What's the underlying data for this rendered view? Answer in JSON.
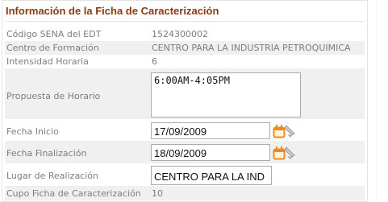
{
  "section": {
    "title": "Información de la Ficha de Caracterización"
  },
  "fields": {
    "codigo": {
      "label": "Código SENA del EDT",
      "value": "1524300002"
    },
    "centro": {
      "label": "Centro de Formación",
      "value": "CENTRO PARA LA INDUSTRIA PETROQUIMICA"
    },
    "intensidad": {
      "label": "Intensidad Horaria",
      "value": "6"
    },
    "propuesta": {
      "label": "Propuesta de Horario",
      "value": "6:00AM-4:05PM"
    },
    "fecha_inicio": {
      "label": "Fecha Inicio",
      "value": "17/09/2009",
      "icon": "calendar-icon"
    },
    "fecha_fin": {
      "label": "Fecha Finalización",
      "value": "18/09/2009",
      "icon": "calendar-icon"
    },
    "lugar": {
      "label": "Lugar de Realización",
      "value": "CENTRO PARA LA IND"
    },
    "cupo": {
      "label": "Cupo Ficha de Caracterización",
      "value": "10"
    }
  },
  "colors": {
    "title": "#8b3a10",
    "label": "#7d7d7d",
    "alt_row": "#f0f0f0",
    "icon_orange": "#f08a1c"
  }
}
